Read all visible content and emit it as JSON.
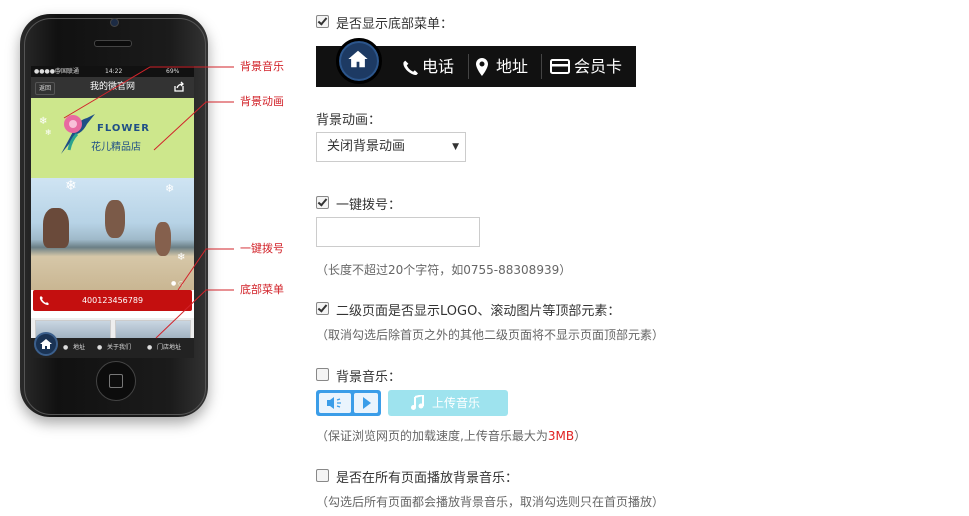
{
  "phone": {
    "status": {
      "carrier": "中国联通",
      "time": "14:22",
      "battery": "69%"
    },
    "nav": {
      "back": "返回",
      "title": "我的微官网"
    },
    "banner": {
      "brand": "FLOWER",
      "brand_cn": "花儿精品店"
    },
    "call_number": "400123456789",
    "bottom_menu": [
      "地址",
      "关于我们",
      "门店地址"
    ]
  },
  "callouts": {
    "music": "背景音乐",
    "animation": "背景动画",
    "call": "一键拨号",
    "bottom_menu": "底部菜单"
  },
  "form": {
    "show_bottom_menu": {
      "label": "是否显示底部菜单：",
      "checked": true
    },
    "menu_demo": {
      "items": [
        "电话",
        "地址",
        "会员卡"
      ]
    },
    "bg_animation": {
      "label": "背景动画：",
      "selected": "关闭背景动画"
    },
    "one_click_call": {
      "label": "一键拨号：",
      "checked": true,
      "value": "",
      "hint": "（长度不超过20个字符，如0755-88308939）"
    },
    "subpage_logo": {
      "label": "二级页面是否显示LOGO、滚动图片等顶部元素：",
      "checked": true,
      "hint": "（取消勾选后除首页之外的其他二级页面将不显示页面顶部元素）"
    },
    "bg_music": {
      "label": "背景音乐：",
      "checked": false,
      "upload": "上传音乐",
      "hint_prefix": "（保证浏览网页的加载速度,上传音乐最大为",
      "hint_limit": "3MB",
      "hint_suffix": "）"
    },
    "music_all_pages": {
      "label": "是否在所有页面播放背景音乐：",
      "checked": false,
      "hint": "（勾选后所有页面都会播放背景音乐，取消勾选则只在首页播放）"
    }
  },
  "colors": {
    "accent_red": "#c40f0f",
    "callout_red": "#d2232a",
    "upload_bg": "#9ee3ee",
    "audio_blue": "#3b9de8"
  }
}
